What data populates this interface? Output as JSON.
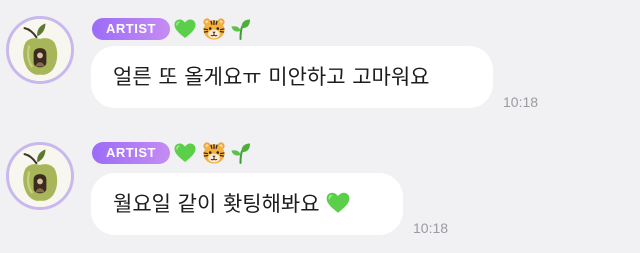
{
  "messages": [
    {
      "badge": "ARTIST",
      "reactions": [
        "green-heart-icon",
        "tiger-face-icon",
        "seedling-icon"
      ],
      "text": "얼른 또 올게요ㅠ 미안하고 고마워요",
      "time": "10:18"
    },
    {
      "badge": "ARTIST",
      "reactions": [
        "green-heart-icon",
        "tiger-face-icon",
        "seedling-icon"
      ],
      "text": "월요일 같이 홧팅해봐요",
      "trailing_emoji": "green-heart-icon",
      "time": "10:18"
    }
  ],
  "colors": {
    "background": "#f1f1f3",
    "badge_start": "#9b6cf7",
    "badge_end": "#c68cf3",
    "avatar_ring": "#c9b8ee",
    "heart": "#5ccf4a"
  }
}
